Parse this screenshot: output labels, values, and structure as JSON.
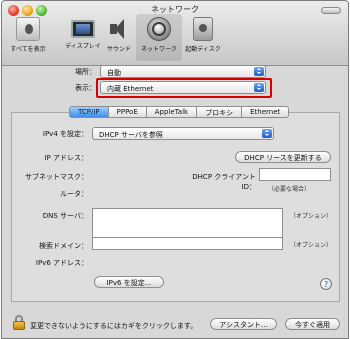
{
  "window": {
    "title": "ネットワーク"
  },
  "toolbar": {
    "items": [
      {
        "label": "すべてを表示",
        "icon": "show-all-icon"
      },
      {
        "label": "ディスプレイ",
        "icon": "display-icon"
      },
      {
        "label": "サウンド",
        "icon": "sound-icon"
      },
      {
        "label": "ネットワーク",
        "icon": "network-icon",
        "active": true
      },
      {
        "label": "起動ディスク",
        "icon": "startup-disk-icon"
      }
    ]
  },
  "location": {
    "label": "場所：",
    "value": "自動"
  },
  "show": {
    "label": "表示：",
    "value": "内蔵 Ethernet"
  },
  "tabs": [
    "TCP/IP",
    "PPPoE",
    "AppleTalk",
    "プロキシ",
    "Ethernet"
  ],
  "active_tab": "TCP/IP",
  "ipv4": {
    "label": "IPv4 を設定：",
    "value": "DHCP サーバを参照"
  },
  "ip_address": {
    "label": "IP アドレス："
  },
  "renew_button": "DHCP リースを更新する",
  "subnet_mask": {
    "label": "サブネットマスク："
  },
  "dhcp_client_id": {
    "label": "DHCP クライアント ID：",
    "hint": "（必要な場合）"
  },
  "router": {
    "label": "ルータ："
  },
  "dns": {
    "label": "DNS サーバ：",
    "note": "（オプション）"
  },
  "search_domain": {
    "label": "検索ドメイン：",
    "note": "（オプション）"
  },
  "ipv6_address": {
    "label": "IPv6 アドレス："
  },
  "ipv6_button": "IPv6 を設定...",
  "help": "?",
  "footer": {
    "lock_text": "変更できないようにするにはカギをクリックします。",
    "assist_button": "アシスタント...",
    "apply_button": "今すぐ適用"
  },
  "colors": {
    "highlight": "#d60000",
    "accent": "#3e8ee8"
  }
}
